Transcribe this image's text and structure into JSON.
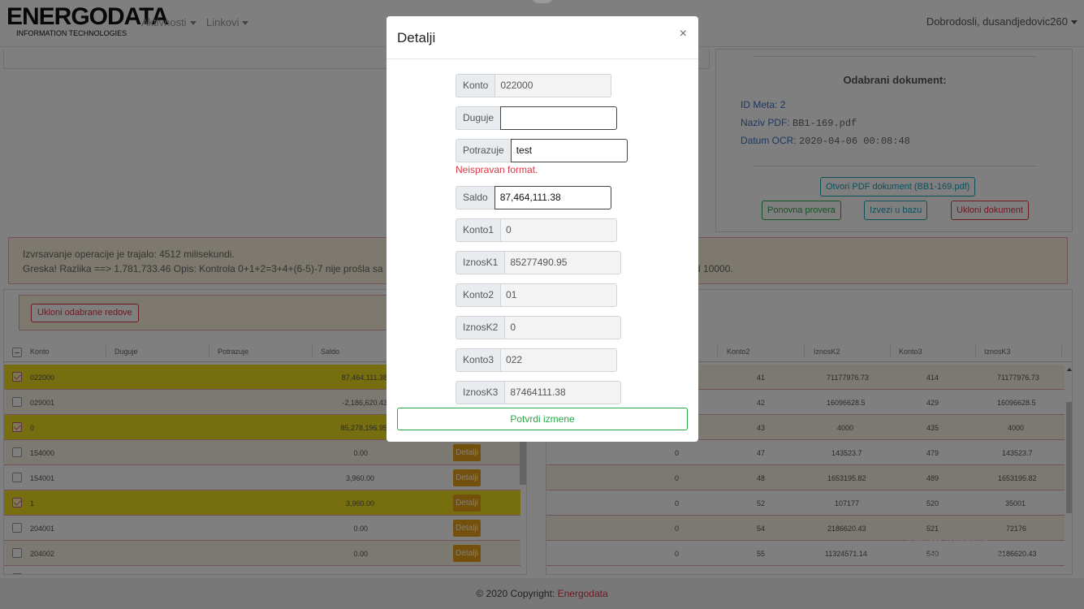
{
  "navbar": {
    "logo_main": "ENERGODATA",
    "logo_sub": "INFORMATION TECHNOLOGIES",
    "menu_activities": "Aktivnosti",
    "menu_links": "Linkovi",
    "welcome": "Dobrodosli, dusandjedovic260"
  },
  "document": {
    "heading": "Odabrani dokument:",
    "id_label": "ID Meta:",
    "id_value": "2",
    "pdf_label": "Naziv PDF:",
    "pdf_value": "BB1-169.pdf",
    "ocr_label": "Datum OCR:",
    "ocr_value": "2020-04-06 00:08:48",
    "open_pdf_button": "Otvori PDF dokument (BB1-169.pdf)",
    "recheck_button": "Ponovna provera",
    "export_button": "Izvezi u bazu",
    "remove_button": "Ukloni dokument"
  },
  "alert": {
    "line1": "Izvrsavanje operacije je trajalo: 4512 milisekundi.",
    "line2_left": "Greska! Razlika ==> 1,781,733.46 Opis: Kontrola 0+1+2=3+4+(6-5)-7 nije prošla sa",
    "line2_right": "d 10000."
  },
  "left_grid": {
    "remove_selected_button": "Ukloni odabrane redove",
    "columns": [
      "Konto",
      "Duguje",
      "Potrazuje",
      "Saldo"
    ],
    "detail_label": "Detalji",
    "rows": [
      {
        "konto": "022000",
        "saldo": "87,464,111.38",
        "checked": true
      },
      {
        "konto": "029001",
        "saldo": "-2,186,620.43",
        "checked": false
      },
      {
        "konto": "0",
        "saldo": "85,278,196.95",
        "checked": true
      },
      {
        "konto": "154000",
        "saldo": "0.00",
        "checked": false
      },
      {
        "konto": "154001",
        "saldo": "3,960.00",
        "checked": false
      },
      {
        "konto": "1",
        "saldo": "3,960.00",
        "checked": true
      },
      {
        "konto": "204001",
        "saldo": "0.00",
        "checked": false
      },
      {
        "konto": "204002",
        "saldo": "0.00",
        "checked": false
      }
    ]
  },
  "right_grid": {
    "columns": [
      "Konto2",
      "IznosK2",
      "Konto3",
      "IznosK3"
    ],
    "rows": [
      {
        "c1": "",
        "c2": "41",
        "c3": "71177976.73",
        "c4": "414",
        "c5": "71177976.73"
      },
      {
        "c1": "",
        "c2": "42",
        "c3": "16096628.5",
        "c4": "429",
        "c5": "16096628.5"
      },
      {
        "c1": "",
        "c2": "43",
        "c3": "4000",
        "c4": "435",
        "c5": "4000"
      },
      {
        "c1": "0",
        "c2": "47",
        "c3": "143523.7",
        "c4": "479",
        "c5": "143523.7"
      },
      {
        "c1": "0",
        "c2": "48",
        "c3": "1653195.82",
        "c4": "489",
        "c5": "1653195.82"
      },
      {
        "c1": "0",
        "c2": "52",
        "c3": "107177",
        "c4": "520",
        "c5": "35001"
      },
      {
        "c1": "0",
        "c2": "54",
        "c3": "2186620.43",
        "c4": "521",
        "c5": "72176"
      },
      {
        "c1": "0",
        "c2": "55",
        "c3": "11324571.14",
        "c4": "540",
        "c5": "2186620.43"
      }
    ]
  },
  "watermark": {
    "title": "Activate Windows",
    "sub": "Go to Settings to activate Windows."
  },
  "footer": {
    "text": "© 2020 Copyright:",
    "brand": "Energodata"
  },
  "modal": {
    "title": "Detalji",
    "close": "×",
    "fields": {
      "konto": {
        "label": "Konto",
        "value": "022000"
      },
      "duguje": {
        "label": "Duguje",
        "value": ""
      },
      "potrazuje": {
        "label": "Potrazuje",
        "value": "test"
      },
      "saldo": {
        "label": "Saldo",
        "value": "87,464,111.38"
      },
      "konto1": {
        "label": "Konto1",
        "value": "0"
      },
      "iznosk1": {
        "label": "IznosK1",
        "value": "85277490.95"
      },
      "konto2": {
        "label": "Konto2",
        "value": "01"
      },
      "iznosk2": {
        "label": "IznosK2",
        "value": "0"
      },
      "konto3": {
        "label": "Konto3",
        "value": "022"
      },
      "iznosk3": {
        "label": "IznosK3",
        "value": "87464111.38"
      }
    },
    "error": "Neispravan format.",
    "confirm_button": "Potvrdi izmene"
  },
  "colors": {
    "selected_row": "#ecdc1f",
    "detail_button": "#e6a118",
    "danger": "#dc3545",
    "success": "#28a745",
    "info": "#17a2b8"
  }
}
